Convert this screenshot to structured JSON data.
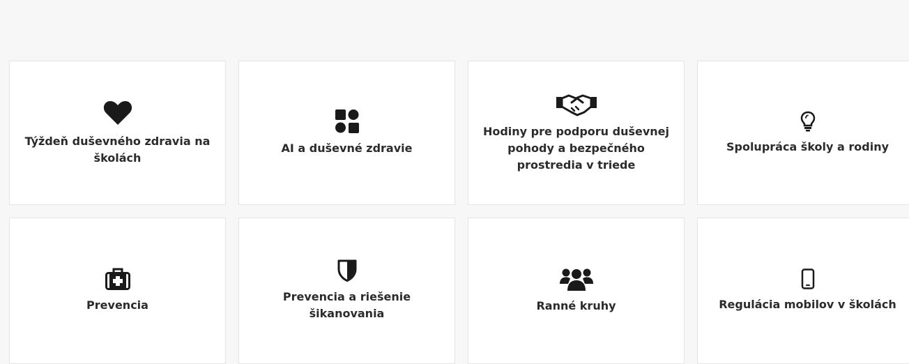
{
  "cards": [
    {
      "label": "Týždeň duševného zdravia na školách",
      "icon": "heart-icon"
    },
    {
      "label": "AI a duševné zdravie",
      "icon": "shapes-icon"
    },
    {
      "label": "Hodiny pre podporu duševnej pohody a bezpečného prostredia v triede",
      "icon": "handshake-icon"
    },
    {
      "label": "Spolupráca školy a rodiny",
      "icon": "lightbulb-icon"
    },
    {
      "label": "Prevencia",
      "icon": "first-aid-kit-icon"
    },
    {
      "label": "Prevencia a riešenie šikanovania",
      "icon": "shield-icon"
    },
    {
      "label": "Ranné kruhy",
      "icon": "users-icon"
    },
    {
      "label": "Regulácia mobilov v školách",
      "icon": "mobile-phone-icon"
    }
  ],
  "colors": {
    "icon": "#1a1a1a",
    "text": "#2b2b2b",
    "card_bg": "#ffffff",
    "page_bg": "#f7f7f7"
  }
}
